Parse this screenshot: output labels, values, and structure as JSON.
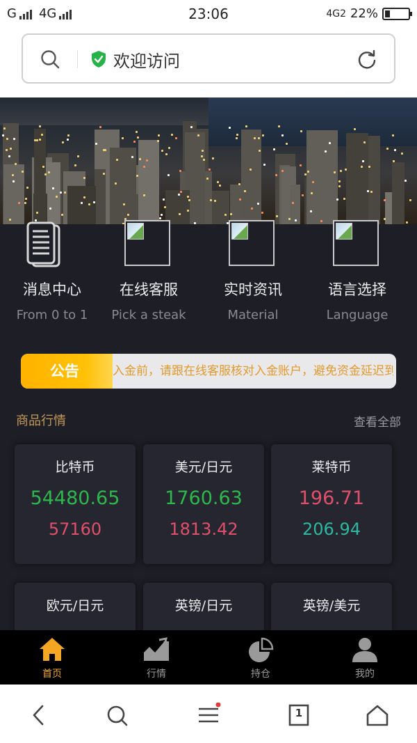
{
  "status_bar": {
    "carrier1": "G",
    "carrier2": "4G",
    "time": "23:06",
    "network": "4G2",
    "battery": "22%",
    "battery_level": 0.22
  },
  "address_bar": {
    "title": "欢迎访问"
  },
  "menu": [
    {
      "label": "消息中心",
      "sub": "From 0 to 1"
    },
    {
      "label": "在线客服",
      "sub": "Pick a steak"
    },
    {
      "label": "实时资讯",
      "sub": "Material"
    },
    {
      "label": "语言选择",
      "sub": "Language"
    }
  ],
  "notice": {
    "tag": "公告",
    "text": "入金前，请跟在线客服核对入金账户，避免资金延迟到"
  },
  "market": {
    "title": "商品行情",
    "view_all": "查看全部"
  },
  "cards": [
    {
      "name": "比特币",
      "price": "54480.65",
      "price2": "57160"
    },
    {
      "name": "美元/日元",
      "price": "1760.63",
      "price2": "1813.42"
    },
    {
      "name": "莱特币",
      "price": "196.71",
      "price2": "206.94"
    },
    {
      "name": "欧元/日元",
      "price": "",
      "price2": ""
    },
    {
      "name": "英镑/日元",
      "price": "",
      "price2": ""
    },
    {
      "name": "英镑/美元",
      "price": "",
      "price2": ""
    }
  ],
  "colors": {
    "up": "#2db84c",
    "down": "#e0506b",
    "accent": "#f5a623"
  },
  "tabs": [
    {
      "label": "首页",
      "icon": "home-icon",
      "active": true
    },
    {
      "label": "行情",
      "icon": "chart-icon",
      "active": false
    },
    {
      "label": "持仓",
      "icon": "pie-icon",
      "active": false
    },
    {
      "label": "我的",
      "icon": "user-icon",
      "active": false
    }
  ],
  "browser_nav": {
    "tab_count": "1"
  }
}
